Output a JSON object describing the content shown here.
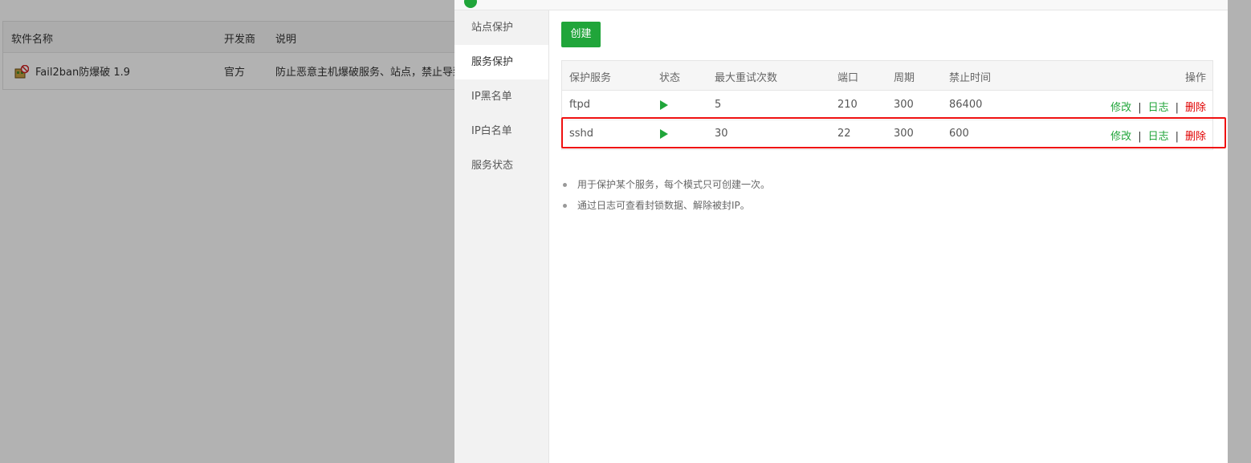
{
  "background_page": {
    "table": {
      "headers": [
        "软件名称",
        "开发商",
        "说明"
      ],
      "rows": [
        {
          "name": "Fail2ban防爆破 1.9",
          "developer": "官方",
          "description": "防止恶意主机爆破服务、站点，禁止导致"
        }
      ]
    }
  },
  "sidebar": {
    "items": [
      {
        "label": "站点保护"
      },
      {
        "label": "服务保护"
      },
      {
        "label": "IP黑名单"
      },
      {
        "label": "IP白名单"
      },
      {
        "label": "服务状态"
      }
    ],
    "active_index": 1
  },
  "toolbar": {
    "create_label": "创建"
  },
  "table": {
    "headers": [
      "保护服务",
      "状态",
      "最大重试次数",
      "端口",
      "周期",
      "禁止时间",
      "操作"
    ],
    "rows": [
      {
        "service": "ftpd",
        "status": "running",
        "max_retry": "5",
        "port": "210",
        "period": "300",
        "ban_time": "86400"
      },
      {
        "service": "sshd",
        "status": "running",
        "max_retry": "30",
        "port": "22",
        "period": "300",
        "ban_time": "600"
      }
    ],
    "actions": {
      "edit": "修改",
      "log": "日志",
      "delete": "删除",
      "separator": "|"
    }
  },
  "tips": [
    "用于保护某个服务，每个模式只可创建一次。",
    "通过日志可查看封锁数据、解除被封IP。"
  ],
  "colors": {
    "accent": "#20a53a",
    "danger": "#e00000",
    "highlight": "#ef1111"
  },
  "icons": {
    "status": "play-icon",
    "app": "fail2ban-app-icon"
  }
}
